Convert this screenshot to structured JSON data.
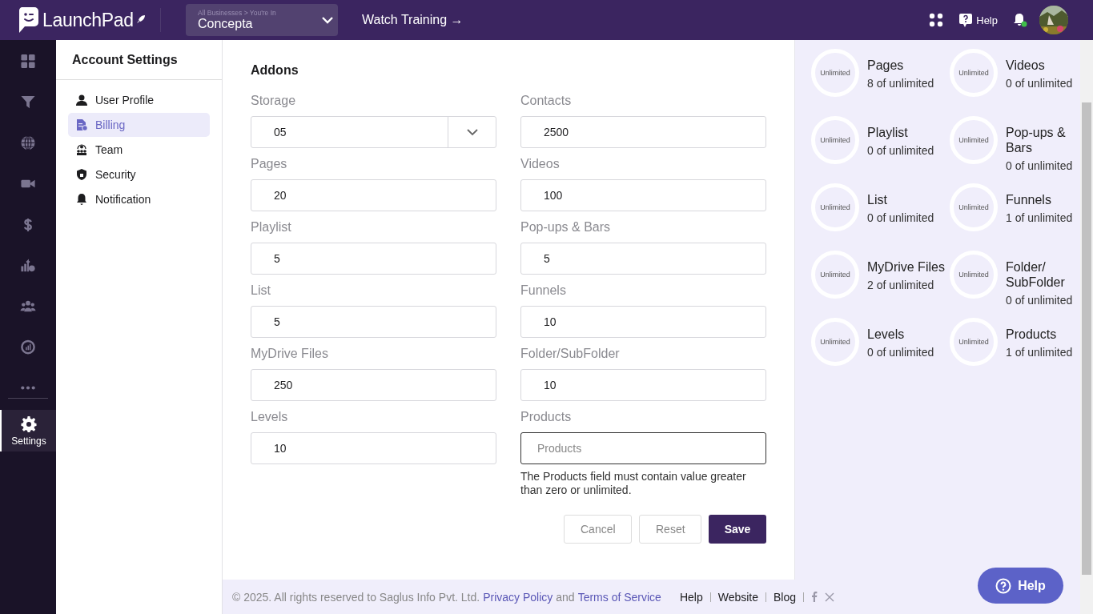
{
  "topbar": {
    "brand": "LaunchPad",
    "business": {
      "caption": "All Businesses > You're In",
      "name": "Concepta"
    },
    "training_link": "Watch Training →",
    "help": "Help",
    "notifications": {
      "unread": true
    }
  },
  "rail": {
    "items": [
      {
        "selected": false
      },
      {
        "selected": false
      },
      {
        "selected": false
      },
      {
        "selected": false
      },
      {
        "selected": false
      },
      {
        "selected": false
      },
      {
        "selected": false
      },
      {
        "selected": false
      },
      {
        "selected": false
      },
      {
        "selected": true,
        "label": "Settings"
      }
    ]
  },
  "settings_menu": {
    "title": "Account Settings",
    "items": [
      {
        "label": "User Profile",
        "selected": false
      },
      {
        "label": "Billing",
        "selected": true
      },
      {
        "label": "Team",
        "selected": false
      },
      {
        "label": "Security",
        "selected": false
      },
      {
        "label": "Notification",
        "selected": false
      }
    ]
  },
  "addons": {
    "title": "Addons",
    "fields": [
      {
        "label": "Storage",
        "kind": "select",
        "value": "05",
        "focused": false
      },
      {
        "label": "Contacts",
        "kind": "text",
        "value": "2500",
        "focused": false
      },
      {
        "label": "Pages",
        "kind": "text",
        "value": "20",
        "focused": false
      },
      {
        "label": "Videos",
        "kind": "text",
        "value": "100",
        "focused": false
      },
      {
        "label": "Playlist",
        "kind": "text",
        "value": "5",
        "focused": false
      },
      {
        "label": "Pop-ups & Bars",
        "kind": "text",
        "value": "5",
        "focused": false
      },
      {
        "label": "List",
        "kind": "text",
        "value": "5",
        "focused": false
      },
      {
        "label": "Funnels",
        "kind": "text",
        "value": "10",
        "focused": false
      },
      {
        "label": "MyDrive Files",
        "kind": "text",
        "value": "250",
        "focused": false
      },
      {
        "label": "Folder/SubFolder",
        "kind": "text",
        "value": "10",
        "focused": false
      },
      {
        "label": "Levels",
        "kind": "text",
        "value": "10",
        "focused": false
      },
      {
        "label": "Products",
        "kind": "text",
        "placeholder": "Products",
        "focused": true,
        "error": "The Products field must contain value greater than zero or unlimited."
      }
    ],
    "buttons": [
      {
        "label": "Cancel",
        "kind": "secondary"
      },
      {
        "label": "Reset",
        "kind": "secondary"
      },
      {
        "label": "Save",
        "kind": "primary"
      }
    ]
  },
  "usage": [
    {
      "ring": "Unlimited",
      "name": "Pages",
      "count": "8 of unlimited"
    },
    {
      "ring": "Unlimited",
      "name": "Videos",
      "count": "0 of unlimited"
    },
    {
      "ring": "Unlimited",
      "name": "Playlist",
      "count": "0 of unlimited"
    },
    {
      "ring": "Unlimited",
      "name": "Pop-ups & Bars",
      "count": "0 of unlimited"
    },
    {
      "ring": "Unlimited",
      "name": "List",
      "count": "0 of unlimited"
    },
    {
      "ring": "Unlimited",
      "name": "Funnels",
      "count": "1 of unlimited"
    },
    {
      "ring": "Unlimited",
      "name": "MyDrive Files",
      "count": "2 of unlimited"
    },
    {
      "ring": "Unlimited",
      "name": "Folder/ SubFolder",
      "count": "0 of unlimited"
    },
    {
      "ring": "Unlimited",
      "name": "Levels",
      "count": "0 of unlimited"
    },
    {
      "ring": "Unlimited",
      "name": "Products",
      "count": "1 of unlimited"
    }
  ],
  "footer": {
    "copyright": "©  2025. All rights reserved to Saglus Info Pvt. Ltd.",
    "privacy": "Privacy Policy",
    "and": "and",
    "terms": "Terms of Service",
    "links": [
      "Help",
      "Website",
      "Blog"
    ]
  },
  "help_button": "Help"
}
